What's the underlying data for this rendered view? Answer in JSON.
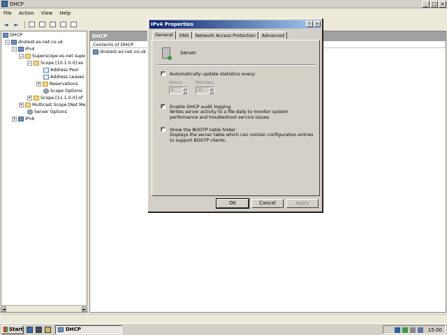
{
  "window": {
    "title": "DHCP",
    "controls": {
      "minimize": "_",
      "maximize": "□",
      "close": "×"
    }
  },
  "menu": [
    "File",
    "Action",
    "View",
    "Help"
  ],
  "toolbar": {
    "back": "◄",
    "forward": "►"
  },
  "tree": {
    "items": [
      {
        "label": "DHCP",
        "icon": "server-icon",
        "expander": ""
      },
      {
        "label": "dnstest.es-net.co.uk",
        "icon": "server-icon",
        "expander": "−"
      },
      {
        "label": "IPv4",
        "icon": "server-icon",
        "expander": "−"
      },
      {
        "label": "Superscope es-net supe",
        "icon": "folder-icon",
        "expander": "−"
      },
      {
        "label": "Scope [10.1.0.0] es",
        "icon": "folder-icon",
        "expander": "−"
      },
      {
        "label": "Address Pool",
        "icon": "doc-icon",
        "expander": ""
      },
      {
        "label": "Address Leases",
        "icon": "doc-icon",
        "expander": ""
      },
      {
        "label": "Reservations",
        "icon": "folder-icon",
        "expander": "+"
      },
      {
        "label": "Scope Options",
        "icon": "gear-icon",
        "expander": ""
      },
      {
        "label": "Scope [11.1.0.0] of",
        "icon": "folder-icon",
        "expander": "+"
      },
      {
        "label": "Multicast Scope [Net Me",
        "icon": "folder-icon",
        "expander": "+"
      },
      {
        "label": "Server Options",
        "icon": "gear-icon",
        "expander": ""
      },
      {
        "label": "IPv6",
        "icon": "server-icon",
        "expander": "+"
      }
    ]
  },
  "right_pane": {
    "header": "DHCP",
    "column": "Contents of DHCP",
    "rows": [
      "dnstest.es-net.co.uk"
    ]
  },
  "dialog": {
    "title": "IPv4 Properties",
    "title_buttons": {
      "help": "?",
      "close": "×"
    },
    "tabs": [
      "General",
      "DNS",
      "Network Access Protection",
      "Advanced"
    ],
    "active_tab": "General",
    "server_label": "Server",
    "auto_update": {
      "label": "Automatically update statistics every:",
      "checked": false,
      "hours_label": "Hours:",
      "minutes_label": "Minutes:",
      "hours_value": "0",
      "minutes_value": "10"
    },
    "audit_logging": {
      "label": "Enable DHCP audit logging",
      "checked": true,
      "check_glyph": "✓",
      "description": "Writes server activity to a file daily to monitor system performance and troubleshoot service issues."
    },
    "bootp": {
      "label": "Show the BOOTP table folder",
      "checked": false,
      "description": "Displays the server table which can contain configuration entries to support BOOTP clients."
    },
    "buttons": {
      "ok": "OK",
      "cancel": "Cancel",
      "apply": "Apply"
    }
  },
  "taskbar": {
    "start": "Start",
    "task": "DHCP",
    "clock": "15:00"
  }
}
